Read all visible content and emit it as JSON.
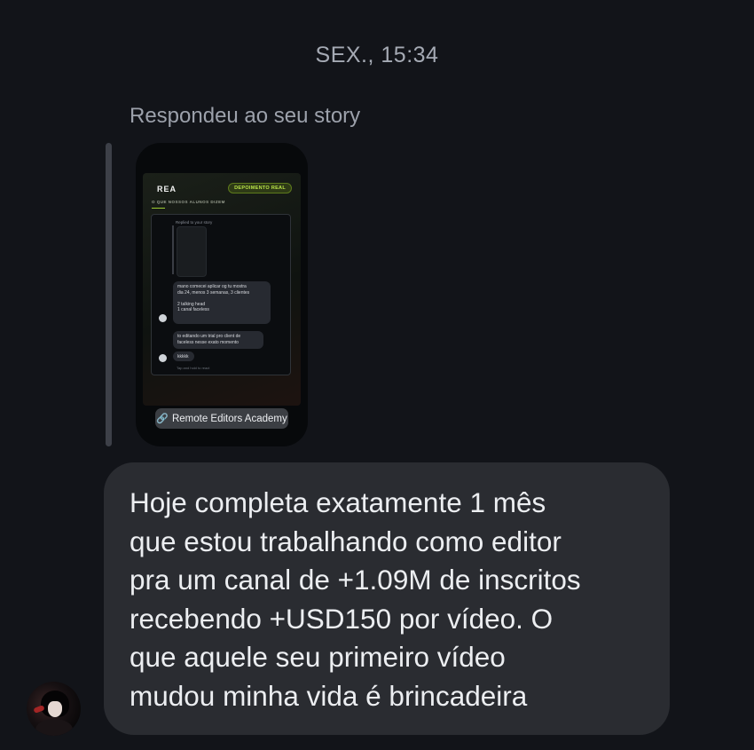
{
  "header": {
    "timestamp": "SEX., 15:34"
  },
  "reply": {
    "label": "Respondeu ao seu story"
  },
  "story": {
    "logo": "REA",
    "badge": "DEPOIMENTO REAL",
    "subtitle": "O QUE NOSSOS ALUNOS DIZEM",
    "inner_label": "Replied to your story",
    "inner_messages": [
      "mano comecei aplicar og tu mostra\ndia 24, menos 3 semanas, 3 clientes\n\n2 talking head\n1 canal faceless",
      "to editando um trial pro client de\nfaceless nesse exato momento",
      "kkkkk"
    ],
    "inner_hint": "Tap and hold to react",
    "link_label": "Remote Editors Academy",
    "link_icon": "link-icon"
  },
  "message": {
    "text": "Hoje completa exatamente 1 mês\nque estou trabalhando como editor\npra um canal de +1.09M de inscritos\nrecebendo +USD150 por vídeo. O\nque aquele seu primeiro vídeo\nmudou minha vida é brincadeira"
  },
  "colors": {
    "background": "#121419",
    "bubble": "#2a2c31",
    "accent_green": "#b9e24a"
  }
}
